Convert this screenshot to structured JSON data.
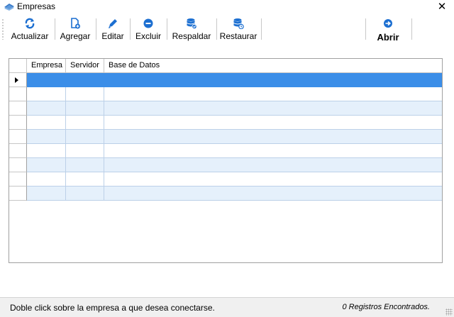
{
  "window": {
    "title": "Empresas",
    "close_symbol": "✕"
  },
  "toolbar": {
    "actualizar": "Actualizar",
    "agregar": "Agregar",
    "editar": "Editar",
    "excluir": "Excluir",
    "respaldar": "Respaldar",
    "restaurar": "Restaurar",
    "abrir": "Abrir"
  },
  "icons": {
    "actualizar": "refresh-icon",
    "agregar": "add-document-icon",
    "editar": "pencil-icon",
    "excluir": "minus-circle-icon",
    "respaldar": "database-check-icon",
    "restaurar": "database-restore-icon",
    "abrir": "arrow-right-circle-icon"
  },
  "colors": {
    "accent": "#1c6fd1",
    "selection": "#3b8ee8",
    "alt_row": "#e5f0fb"
  },
  "grid": {
    "columns": [
      "Empresa",
      "Servidor",
      "Base de Datos"
    ],
    "rows": [
      {
        "empresa": "",
        "servidor": "",
        "base_de_datos": "",
        "selected": true
      },
      {
        "empresa": "",
        "servidor": "",
        "base_de_datos": ""
      },
      {
        "empresa": "",
        "servidor": "",
        "base_de_datos": ""
      },
      {
        "empresa": "",
        "servidor": "",
        "base_de_datos": ""
      },
      {
        "empresa": "",
        "servidor": "",
        "base_de_datos": ""
      },
      {
        "empresa": "",
        "servidor": "",
        "base_de_datos": ""
      },
      {
        "empresa": "",
        "servidor": "",
        "base_de_datos": ""
      },
      {
        "empresa": "",
        "servidor": "",
        "base_de_datos": ""
      },
      {
        "empresa": "",
        "servidor": "",
        "base_de_datos": ""
      }
    ]
  },
  "status": {
    "hint": "Doble click sobre la empresa a que desea conectarse.",
    "count": "0 Registros Encontrados."
  }
}
